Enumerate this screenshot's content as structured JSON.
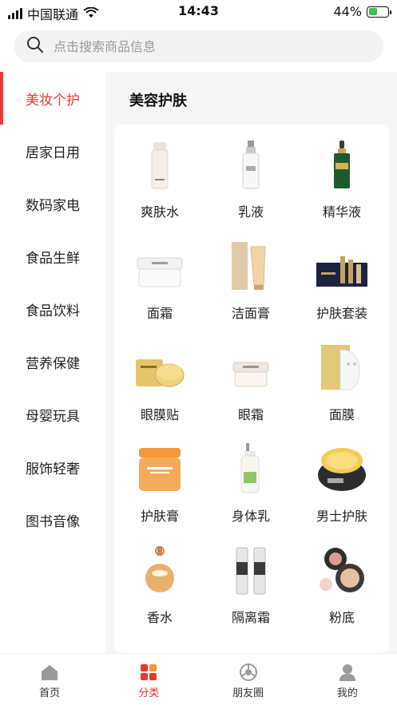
{
  "status_bar": {
    "carrier": "中国联通",
    "time": "14:43",
    "battery": "44%",
    "battery_level": 0.44
  },
  "search": {
    "placeholder": "点击搜索商品信息"
  },
  "sidebar": {
    "items": [
      {
        "label": "美妆个护",
        "active": true
      },
      {
        "label": "居家日用"
      },
      {
        "label": "数码家电"
      },
      {
        "label": "食品生鲜"
      },
      {
        "label": "食品饮料"
      },
      {
        "label": "营养保健"
      },
      {
        "label": "母婴玩具"
      },
      {
        "label": "服饰轻奢"
      },
      {
        "label": "图书音像"
      }
    ]
  },
  "content": {
    "title": "美容护肤",
    "products": [
      {
        "label": "爽肤水",
        "icon": "toner-bottle-icon"
      },
      {
        "label": "乳液",
        "icon": "lotion-bottle-icon"
      },
      {
        "label": "精华液",
        "icon": "serum-bottle-icon"
      },
      {
        "label": "面霜",
        "icon": "cream-jar-icon"
      },
      {
        "label": "洁面膏",
        "icon": "cleanser-tube-icon"
      },
      {
        "label": "护肤套装",
        "icon": "skincare-set-icon"
      },
      {
        "label": "眼膜贴",
        "icon": "eye-mask-icon"
      },
      {
        "label": "眼霜",
        "icon": "eye-cream-jar-icon"
      },
      {
        "label": "面膜",
        "icon": "face-mask-icon"
      },
      {
        "label": "护肤膏",
        "icon": "skin-balm-jar-icon"
      },
      {
        "label": "身体乳",
        "icon": "body-lotion-bottle-icon"
      },
      {
        "label": "男士护肤",
        "icon": "mens-mask-jar-icon"
      },
      {
        "label": "香水",
        "icon": "perfume-bottle-icon"
      },
      {
        "label": "隔离霜",
        "icon": "primer-bottle-icon"
      },
      {
        "label": "粉底",
        "icon": "foundation-compact-icon"
      }
    ]
  },
  "tabbar": {
    "tabs": [
      {
        "label": "首页",
        "icon": "home-icon"
      },
      {
        "label": "分类",
        "icon": "category-icon",
        "active": true
      },
      {
        "label": "朋友圈",
        "icon": "moments-icon"
      },
      {
        "label": "我的",
        "icon": "profile-icon"
      }
    ]
  },
  "colors": {
    "accent": "#e8382f",
    "background": "#f6f6f6",
    "search_bg": "#f3f3f3"
  }
}
